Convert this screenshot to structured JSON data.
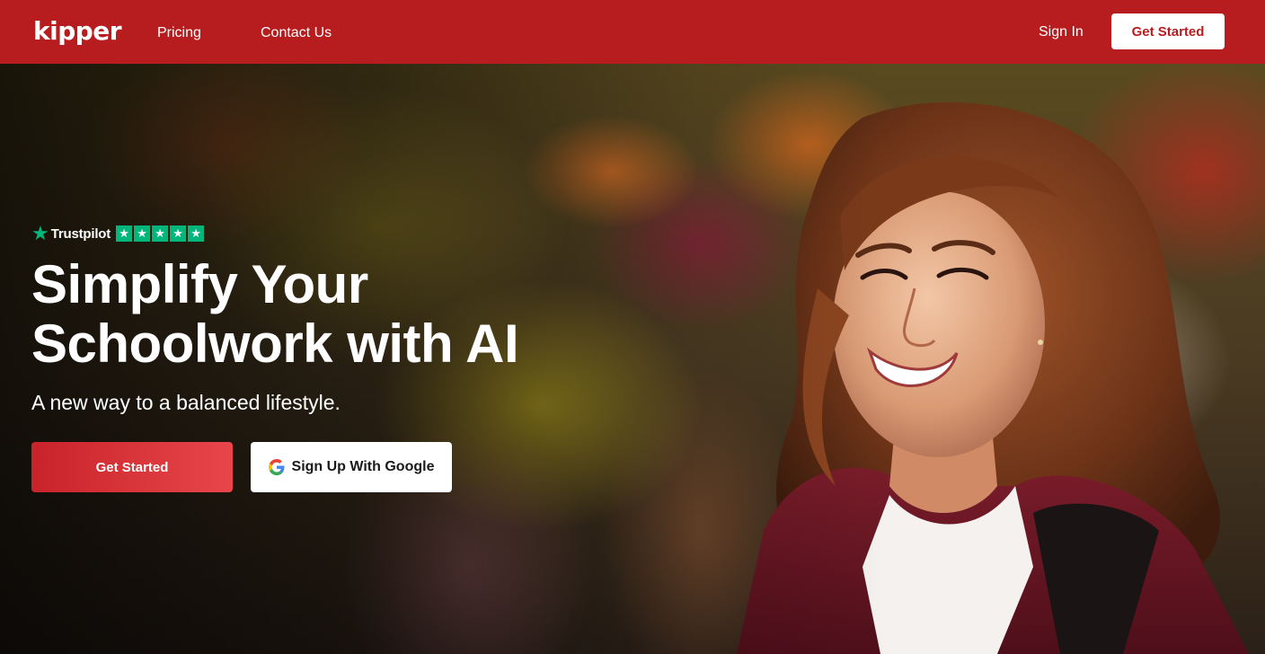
{
  "nav": {
    "logo": "kipper",
    "links": [
      "Pricing",
      "Contact Us"
    ],
    "sign_in": "Sign In",
    "get_started": "Get Started"
  },
  "hero": {
    "trustpilot": {
      "label": "Trustpilot",
      "stars": 5,
      "brand_color": "#00b67a"
    },
    "headline": "Simplify Your Schoolwork with AI",
    "subheadline": "A new way to a balanced lifestyle.",
    "primary_cta": "Get Started",
    "google_cta": "Sign Up With Google",
    "image_description_icon": "smiling-student-photo"
  },
  "colors": {
    "brand": "#b71c1f",
    "cta_gradient": [
      "#c8232a",
      "#e8464a"
    ]
  }
}
